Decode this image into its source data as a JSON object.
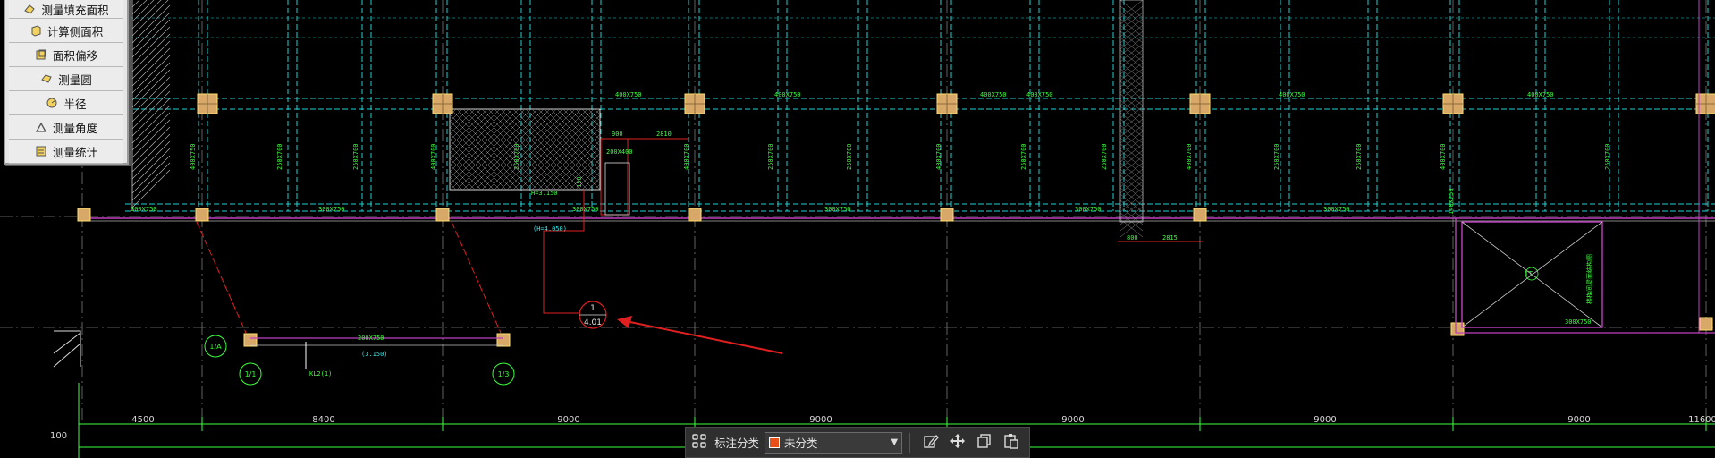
{
  "tool_menu": {
    "items": [
      {
        "label": "测量填充面积",
        "icon": "fill-area-icon"
      },
      {
        "label": "计算侧面积",
        "icon": "side-area-icon"
      },
      {
        "label": "面积偏移",
        "icon": "area-offset-icon"
      },
      {
        "label": "测量圆",
        "icon": "measure-circle-icon"
      },
      {
        "label": "半径",
        "icon": "radius-icon"
      },
      {
        "label": "测量角度",
        "icon": "angle-icon"
      },
      {
        "label": "测量统计",
        "icon": "statistics-icon"
      }
    ]
  },
  "drawing": {
    "bottom_dimensions": [
      "4500",
      "8400",
      "9000",
      "9000",
      "9000",
      "9000",
      "9000",
      "11600"
    ],
    "left_dimension": "100",
    "beam_labels": {
      "top_row": [
        "400X750",
        "400X750",
        "400X750",
        "400X750",
        "400X750",
        "400X750"
      ],
      "mid_row": [
        "300X750",
        "300X750",
        "300X750",
        "300X750",
        "300X750",
        "300X750"
      ],
      "vertical": [
        "400X750",
        "250X700",
        "250X700",
        "400X700",
        "250X700",
        "400X700",
        "250X700",
        "250X700",
        "400X700",
        "250X700",
        "250X700",
        "400X700",
        "250X700",
        "250X700",
        "400X700",
        "250X700"
      ],
      "lower_beam": "200X750",
      "lower_beam_elev": "(3.150)",
      "side_beam": "300X750",
      "side_beam_vertical": "140X750"
    },
    "small_dims": {
      "d900": "900",
      "d2810": "2810",
      "d800": "800",
      "d2815": "2815",
      "d200x400": "200X400",
      "d150": "150"
    },
    "opening_note": "(H=4.050)",
    "opening_note2": "H=3.150",
    "axis_bubbles": [
      "1/A",
      "1/1",
      "1/3"
    ],
    "callout": {
      "top": "1",
      "bottom": "4.01"
    },
    "lower_label": "KL2(1)",
    "opening_label": "LT",
    "opening_side_text": "楼梯间屋面结构图"
  },
  "toolbar": {
    "label": "标注分类",
    "select_value": "未分类",
    "swatch_color": "#e8501a",
    "buttons": [
      "grid-icon",
      "edit-icon",
      "move-icon",
      "copy-icon",
      "paste-icon"
    ]
  },
  "colors": {
    "background": "#000000",
    "grid_cyan": "#20d0d0",
    "beam_label_green": "#3cff3c",
    "column_fill": "#d8a868",
    "magenta": "#c040c0",
    "red": "#e02020"
  }
}
